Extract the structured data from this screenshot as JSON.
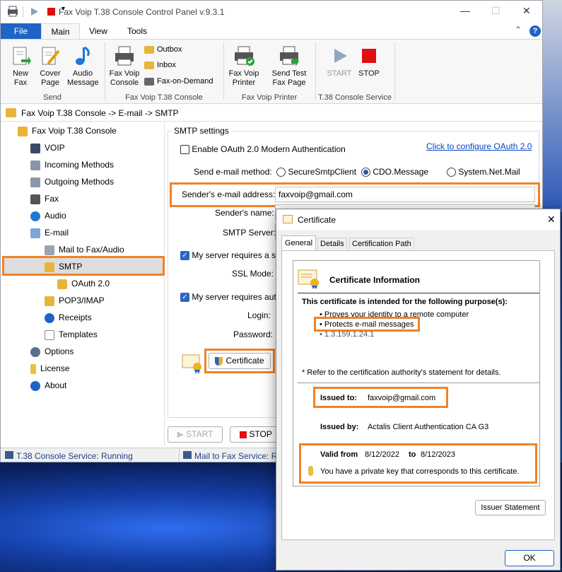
{
  "window": {
    "title": "Fax Voip T.38 Console Control Panel v.9.3.1"
  },
  "tabs": [
    "File",
    "Main",
    "View",
    "Tools"
  ],
  "ribbon": {
    "send": {
      "new_fax": "New\nFax",
      "cover_page": "Cover\nPage",
      "audio_message": "Audio\nMessage",
      "group": "Send"
    },
    "console": {
      "console": "Fax Voip\nConsole",
      "outbox": "Outbox",
      "inbox": "Inbox",
      "fax_on_demand": "Fax-on-Demand",
      "group": "Fax Voip T.38 Console"
    },
    "printer": {
      "fax_voip_printer": "Fax Voip\nPrinter",
      "send_test": "Send Test\nFax Page",
      "group": "Fax Voip Printer"
    },
    "service": {
      "start": "START",
      "stop": "STOP",
      "group": "T.38 Console Service"
    }
  },
  "breadcrumb": "Fax Voip T.38 Console -> E-mail -> SMTP",
  "tree": {
    "root": "Fax Voip T.38 Console",
    "voip": "VOIP",
    "incoming": "Incoming Methods",
    "outgoing": "Outgoing Methods",
    "fax": "Fax",
    "audio": "Audio",
    "email": "E-mail",
    "mail_to_fax": "Mail to Fax/Audio",
    "smtp": "SMTP",
    "oauth": "OAuth 2.0",
    "pop3": "POP3/IMAP",
    "receipts": "Receipts",
    "templates": "Templates",
    "options": "Options",
    "license": "License",
    "about": "About"
  },
  "smtp": {
    "group": "SMTP settings",
    "oauth_enable": "Enable OAuth 2.0 Modern Authentication",
    "oauth_link": "Click to configure OAuth 2.0",
    "method_label": "Send e-mail method:",
    "methods": [
      "SecureSmtpClient",
      "CDO.Message",
      "System.Net.Mail"
    ],
    "sender_addr_label": "Sender's e-mail address:",
    "sender_addr_value": "faxvoip@gmail.com",
    "sender_name_label": "Sender's name:",
    "server_label": "SMTP Server:",
    "secure_check": "My server requires a se",
    "ssl_label": "SSL Mode:",
    "auth_check": "My server requires auth",
    "login_label": "Login:",
    "password_label": "Password:",
    "cert_button": "Certificate",
    "start": "START",
    "stop": "STOP"
  },
  "status": {
    "left": "T.38 Console Service: Running",
    "right": "Mail to Fax Service: Ru"
  },
  "cert": {
    "title": "Certificate",
    "tabs": [
      "General",
      "Details",
      "Certification Path"
    ],
    "info_title": "Certificate Information",
    "purpose_heading": "This certificate is intended for the following purpose(s):",
    "purposes": [
      "• Proves your identity to a remote computer",
      "• Protects e-mail messages",
      "• 1.3.159.1.24.1"
    ],
    "refer": "* Refer to the certification authority's statement for details.",
    "issued_to_label": "Issued to:",
    "issued_to": "faxvoip@gmail.com",
    "issued_by_label": "Issued by:",
    "issued_by": "Actalis Client Authentication CA G3",
    "valid_from_label": "Valid from",
    "valid_from": "8/12/2022",
    "to_label": "to",
    "valid_to": "8/12/2023",
    "private_key": "You have a private key that corresponds to this certificate.",
    "issuer_button": "Issuer Statement",
    "ok": "OK"
  },
  "colors": {
    "accent": "#f08226",
    "file_tab": "#1f63c6"
  }
}
